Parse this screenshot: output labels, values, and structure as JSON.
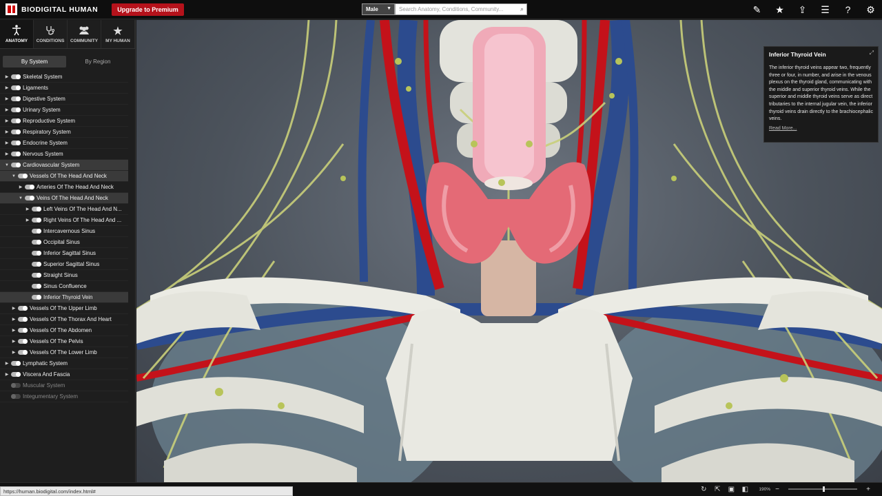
{
  "app": {
    "logo_text": "BIODIGITAL HUMAN",
    "premium_label": "Upgrade to Premium"
  },
  "search": {
    "gender": "Male",
    "placeholder": "Search Anatomy, Conditions, Community..."
  },
  "top_icons": [
    "pencil-icon",
    "star-icon",
    "share-icon",
    "checklist-icon",
    "help-icon",
    "gear-icon"
  ],
  "main_tabs": [
    {
      "label": "ANATOMY",
      "icon": "figure-icon"
    },
    {
      "label": "CONDITIONS",
      "icon": "stethoscope-icon"
    },
    {
      "label": "COMMUNITY",
      "icon": "people-icon"
    },
    {
      "label": "MY HUMAN",
      "icon": "star-icon"
    }
  ],
  "sub_tabs": [
    "By System",
    "By Region"
  ],
  "tree": [
    {
      "label": "Skeletal System",
      "level": 0,
      "arrow": "right",
      "on": true
    },
    {
      "label": "Ligaments",
      "level": 0,
      "arrow": "right",
      "on": true
    },
    {
      "label": "Digestive System",
      "level": 0,
      "arrow": "right",
      "on": true
    },
    {
      "label": "Urinary System",
      "level": 0,
      "arrow": "right",
      "on": true
    },
    {
      "label": "Reproductive System",
      "level": 0,
      "arrow": "right",
      "on": true
    },
    {
      "label": "Respiratory System",
      "level": 0,
      "arrow": "right",
      "on": true
    },
    {
      "label": "Endocrine System",
      "level": 0,
      "arrow": "right",
      "on": true
    },
    {
      "label": "Nervous System",
      "level": 0,
      "arrow": "right",
      "on": true
    },
    {
      "label": "Cardiovascular System",
      "level": 0,
      "arrow": "down",
      "on": true,
      "selected": true
    },
    {
      "label": "Vessels Of The Head And Neck",
      "level": 1,
      "arrow": "down",
      "on": true,
      "selected": true
    },
    {
      "label": "Arteries Of The Head And Neck",
      "level": 2,
      "arrow": "right",
      "on": true
    },
    {
      "label": "Veins Of The Head And Neck",
      "level": 2,
      "arrow": "down",
      "on": true,
      "selected": true
    },
    {
      "label": "Left Veins Of The Head And N...",
      "level": 3,
      "arrow": "right",
      "on": true
    },
    {
      "label": "Right Veins Of The Head And ...",
      "level": 3,
      "arrow": "right",
      "on": true
    },
    {
      "label": "Intercavernous Sinus",
      "level": 3,
      "arrow": "",
      "on": true
    },
    {
      "label": "Occipital Sinus",
      "level": 3,
      "arrow": "",
      "on": true
    },
    {
      "label": "Inferior Sagittal Sinus",
      "level": 3,
      "arrow": "",
      "on": true
    },
    {
      "label": "Superior Sagittal Sinus",
      "level": 3,
      "arrow": "",
      "on": true
    },
    {
      "label": "Straight Sinus",
      "level": 3,
      "arrow": "",
      "on": true
    },
    {
      "label": "Sinus Confluence",
      "level": 3,
      "arrow": "",
      "on": true
    },
    {
      "label": "Inferior Thyroid Vein",
      "level": 3,
      "arrow": "",
      "on": true,
      "selected": true
    },
    {
      "label": "Vessels Of The Upper Limb",
      "level": 1,
      "arrow": "right",
      "on": true
    },
    {
      "label": "Vessels Of The Thorax And Heart",
      "level": 1,
      "arrow": "right",
      "on": true
    },
    {
      "label": "Vessels Of The Abdomen",
      "level": 1,
      "arrow": "right",
      "on": true
    },
    {
      "label": "Vessels Of The Pelvis",
      "level": 1,
      "arrow": "right",
      "on": true
    },
    {
      "label": "Vessels Of The Lower Limb",
      "level": 1,
      "arrow": "right",
      "on": true
    },
    {
      "label": "Lymphatic System",
      "level": 0,
      "arrow": "right",
      "on": true
    },
    {
      "label": "Viscera And Fascia",
      "level": 0,
      "arrow": "right",
      "on": true
    },
    {
      "label": "Muscular System",
      "level": 0,
      "arrow": "",
      "on": false,
      "dim": true
    },
    {
      "label": "Integumentary System",
      "level": 0,
      "arrow": "",
      "on": false,
      "dim": true
    }
  ],
  "info_panel": {
    "title": "Inferior Thyroid Vein",
    "body": "The inferior thyroid veins appear two, frequently three or four, in number, and arise in the venous plexus on the thyroid gland, communicating with the middle and superior thyroid veins. While the superior and middle thyroid veins serve as direct tributaries to the internal jugular vein, the inferior thyroid veins drain directly to the brachiocephalic veins.",
    "link": "Read More..."
  },
  "status_url": "https://human.biodigital.com/index.html#",
  "zoom_label": "190%",
  "colors": {
    "brand_red": "#b5121b",
    "vein": "#2f4f8f",
    "artery": "#c4121a",
    "nerve": "#c9cf7a",
    "bone": "#e9e9e2",
    "thyroid": "#e46a76",
    "trachea": "#f0aab8"
  }
}
